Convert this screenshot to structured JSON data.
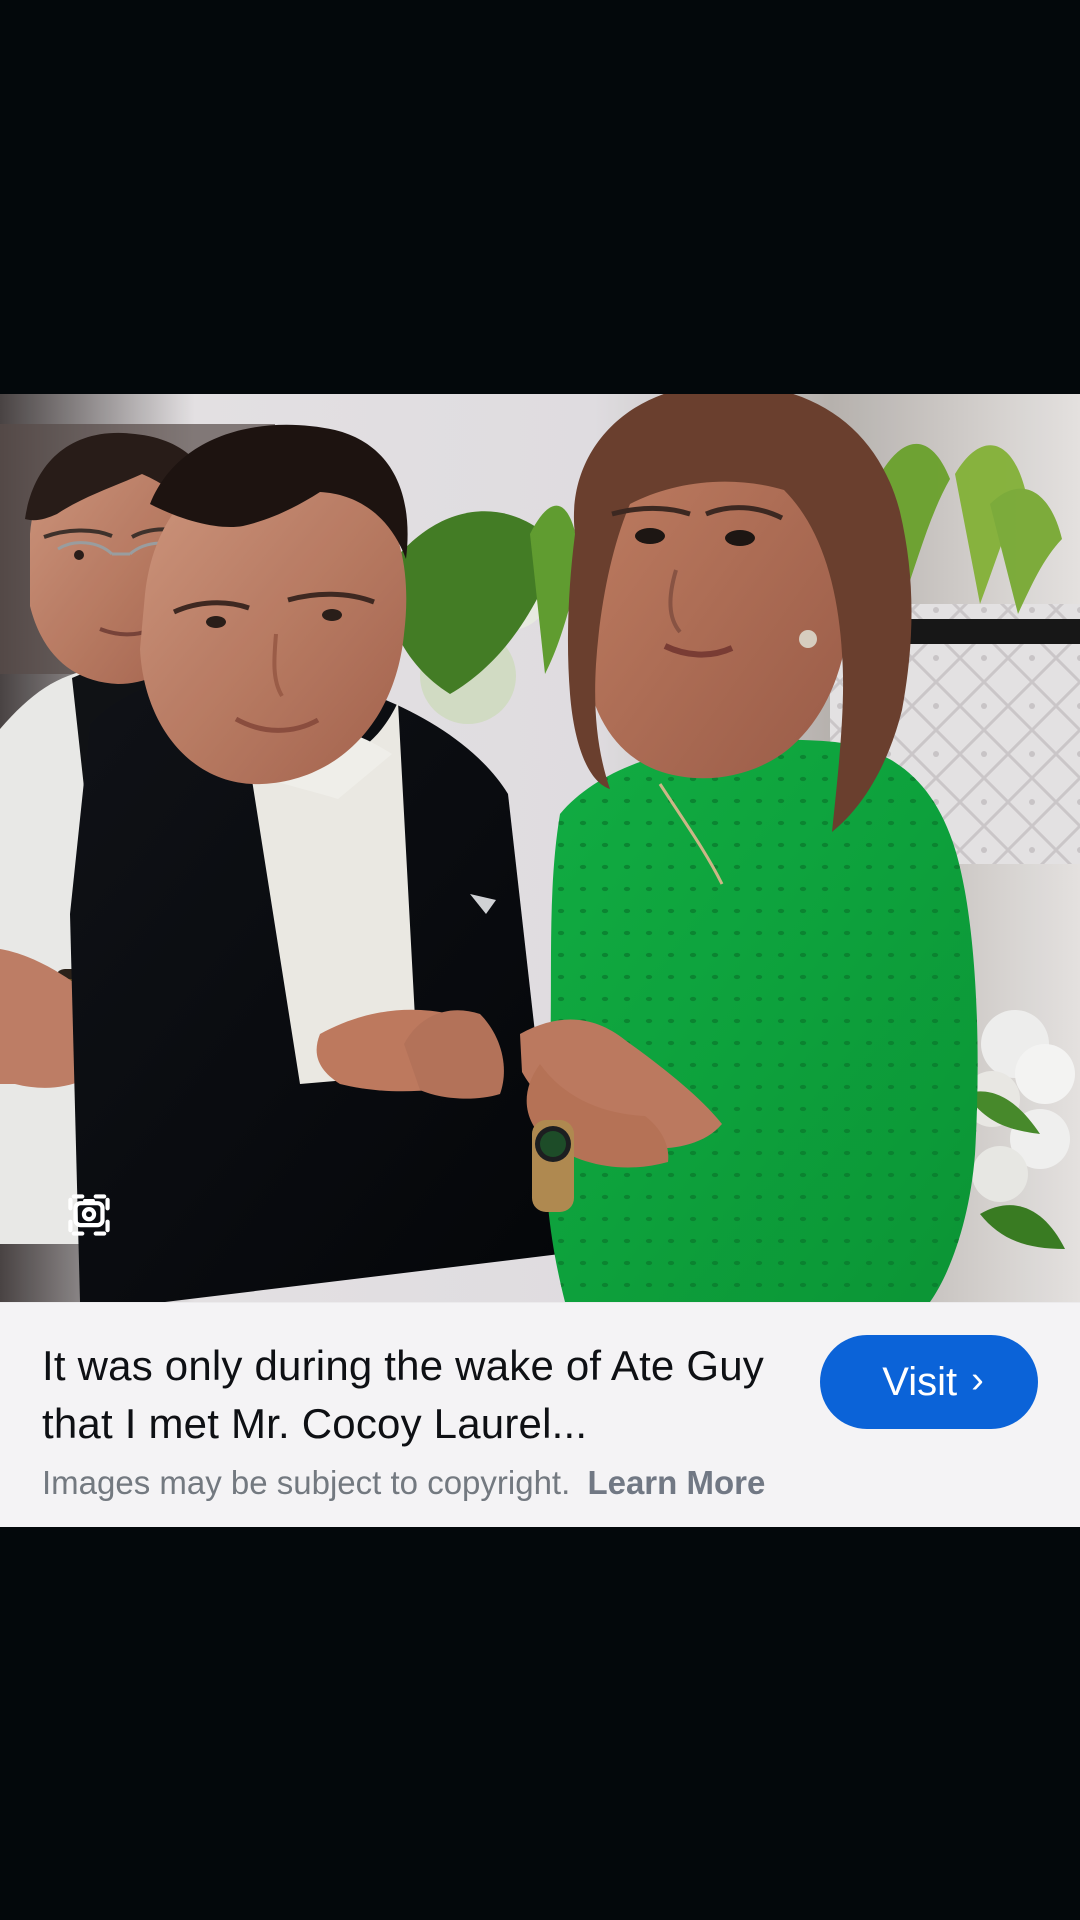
{
  "image_result": {
    "caption": "It was only during the wake of Ate Guy that I met Mr. Cocoy Laurel...",
    "visit_label": "Visit",
    "copyright_text": "Images may be subject to copyright.",
    "learn_more_label": "Learn More"
  },
  "icons": {
    "lens": "camera-search-icon",
    "visit": "chevron-right-icon"
  },
  "colors": {
    "background": "#03080b",
    "card": "#f4f3f5",
    "primary_button": "#0b63d8",
    "caption_text": "#0e1014",
    "secondary_text": "#737980"
  }
}
